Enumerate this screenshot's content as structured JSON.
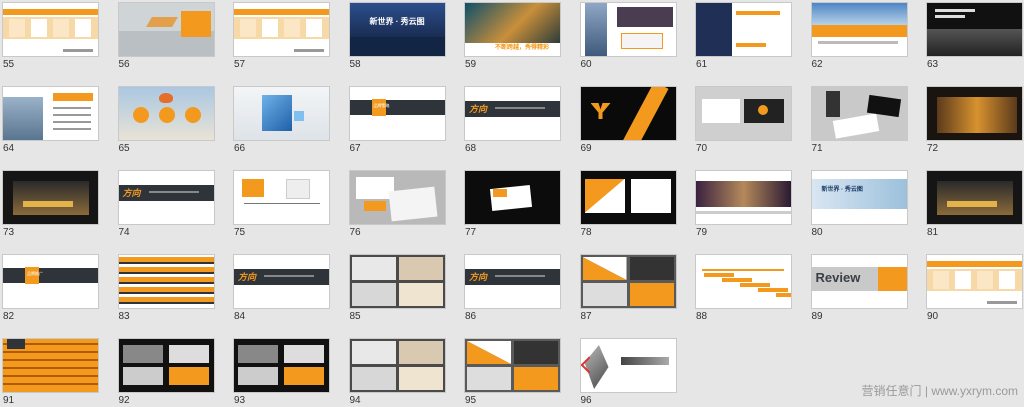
{
  "colors": {
    "orange": "#f39a1e",
    "dark": "#2f343b",
    "black": "#0b0b0b",
    "white": "#ffffff",
    "gray": "#bdbdbd",
    "bg": "#e6e6e6"
  },
  "watermark": "营销任意门 | www.yxrym.com",
  "slides": [
    {
      "num": "55",
      "style": "table"
    },
    {
      "num": "56",
      "style": "graph"
    },
    {
      "num": "57",
      "style": "table2"
    },
    {
      "num": "58",
      "style": "cityblue",
      "text": "新世界 · 秀云图"
    },
    {
      "num": "59",
      "style": "wave",
      "text": "不断跨越，秀得精彩"
    },
    {
      "num": "60",
      "style": "tower"
    },
    {
      "num": "61",
      "style": "nightcity"
    },
    {
      "num": "62",
      "style": "skyline"
    },
    {
      "num": "63",
      "style": "bwcity"
    },
    {
      "num": "64",
      "style": "citytxt"
    },
    {
      "num": "65",
      "style": "clouds"
    },
    {
      "num": "66",
      "style": "cubes"
    },
    {
      "num": "67",
      "style": "band",
      "text": "品牌策略"
    },
    {
      "num": "68",
      "style": "band2",
      "text": "方向"
    },
    {
      "num": "69",
      "style": "ylogo"
    },
    {
      "num": "70",
      "style": "cards"
    },
    {
      "num": "71",
      "style": "cards2"
    },
    {
      "num": "72",
      "style": "bridge"
    },
    {
      "num": "73",
      "style": "hall"
    },
    {
      "num": "74",
      "style": "band2",
      "text": "方向"
    },
    {
      "num": "75",
      "style": "logos"
    },
    {
      "num": "76",
      "style": "stationery"
    },
    {
      "num": "77",
      "style": "card3"
    },
    {
      "num": "78",
      "style": "tri"
    },
    {
      "num": "79",
      "style": "banner"
    },
    {
      "num": "80",
      "style": "banner2",
      "text": "新世界 · 秀云图"
    },
    {
      "num": "81",
      "style": "hall2"
    },
    {
      "num": "82",
      "style": "band",
      "text": "品牌推广"
    },
    {
      "num": "83",
      "style": "stripes"
    },
    {
      "num": "84",
      "style": "band2",
      "text": "方向"
    },
    {
      "num": "85",
      "style": "books"
    },
    {
      "num": "86",
      "style": "band2",
      "text": "方向"
    },
    {
      "num": "87",
      "style": "quad"
    },
    {
      "num": "88",
      "style": "timeline"
    },
    {
      "num": "89",
      "style": "review",
      "text": "Review"
    },
    {
      "num": "90",
      "style": "table"
    },
    {
      "num": "91",
      "style": "stripes2"
    },
    {
      "num": "92",
      "style": "darkquad"
    },
    {
      "num": "93",
      "style": "darkquad2"
    },
    {
      "num": "94",
      "style": "books2"
    },
    {
      "num": "95",
      "style": "quad2"
    },
    {
      "num": "96",
      "style": "ink"
    }
  ]
}
